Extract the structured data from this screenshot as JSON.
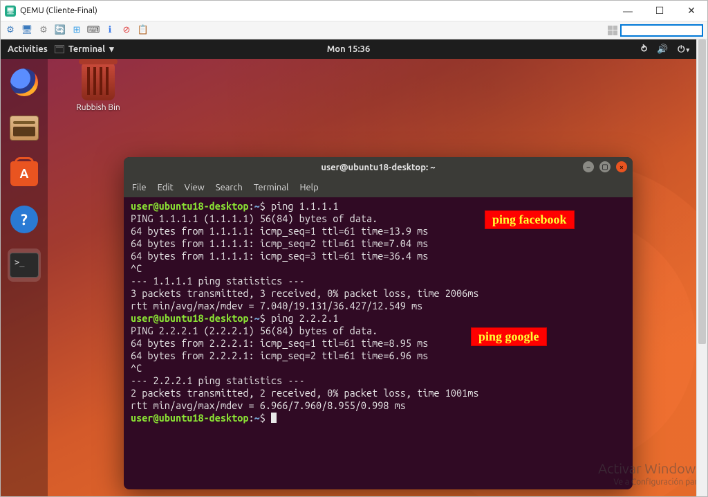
{
  "win": {
    "title": "QEMU (Cliente-Final)",
    "icon_glyph": "🖥"
  },
  "qemu_toolbar_icons": [
    {
      "name": "cog-pair-icon",
      "glyph": "⚙"
    },
    {
      "name": "monitor-icon",
      "glyph": "🖥"
    },
    {
      "name": "gear-icon",
      "glyph": "⚙"
    },
    {
      "name": "refresh-icon",
      "glyph": "🔄"
    },
    {
      "name": "windows-key-icon",
      "glyph": "⊞"
    },
    {
      "name": "keyboard-icon",
      "glyph": "⌨"
    },
    {
      "name": "info-icon",
      "glyph": "ℹ"
    },
    {
      "name": "close-red-icon",
      "glyph": "⊘"
    },
    {
      "name": "clipboard-icon",
      "glyph": "📋"
    }
  ],
  "gnome": {
    "activities": "Activities",
    "app_label": "Terminal",
    "clock": "Mon 15:36"
  },
  "desktop": {
    "trash_label": "Rubbish Bin"
  },
  "terminal": {
    "title": "user@ubuntu18-desktop: ~",
    "menus": [
      "File",
      "Edit",
      "View",
      "Search",
      "Terminal",
      "Help"
    ],
    "prompt_user": "user@ubuntu18-desktop",
    "prompt_path": "~",
    "lines": [
      {
        "t": "cmd",
        "cmd": "ping 1.1.1.1"
      },
      {
        "t": "out",
        "text": "PING 1.1.1.1 (1.1.1.1) 56(84) bytes of data."
      },
      {
        "t": "out",
        "text": "64 bytes from 1.1.1.1: icmp_seq=1 ttl=61 time=13.9 ms"
      },
      {
        "t": "out",
        "text": "64 bytes from 1.1.1.1: icmp_seq=2 ttl=61 time=7.04 ms"
      },
      {
        "t": "out",
        "text": "64 bytes from 1.1.1.1: icmp_seq=3 ttl=61 time=36.4 ms"
      },
      {
        "t": "out",
        "text": "^C"
      },
      {
        "t": "out",
        "text": "--- 1.1.1.1 ping statistics ---"
      },
      {
        "t": "out",
        "text": "3 packets transmitted, 3 received, 0% packet loss, time 2006ms"
      },
      {
        "t": "out",
        "text": "rtt min/avg/max/mdev = 7.040/19.131/36.427/12.549 ms"
      },
      {
        "t": "cmd",
        "cmd": "ping 2.2.2.1"
      },
      {
        "t": "out",
        "text": "PING 2.2.2.1 (2.2.2.1) 56(84) bytes of data."
      },
      {
        "t": "out",
        "text": "64 bytes from 2.2.2.1: icmp_seq=1 ttl=61 time=8.95 ms"
      },
      {
        "t": "out",
        "text": "64 bytes from 2.2.2.1: icmp_seq=2 ttl=61 time=6.96 ms"
      },
      {
        "t": "out",
        "text": "^C"
      },
      {
        "t": "out",
        "text": "--- 2.2.2.1 ping statistics ---"
      },
      {
        "t": "out",
        "text": "2 packets transmitted, 2 received, 0% packet loss, time 1001ms"
      },
      {
        "t": "out",
        "text": "rtt min/avg/max/mdev = 6.966/7.960/8.955/0.998 ms"
      },
      {
        "t": "cmd",
        "cmd": ""
      }
    ]
  },
  "annotations": {
    "a1": "ping facebook",
    "a2": "ping google"
  },
  "watermark": {
    "title": "Activar Windows",
    "sub": "Ve a Configuración para"
  }
}
